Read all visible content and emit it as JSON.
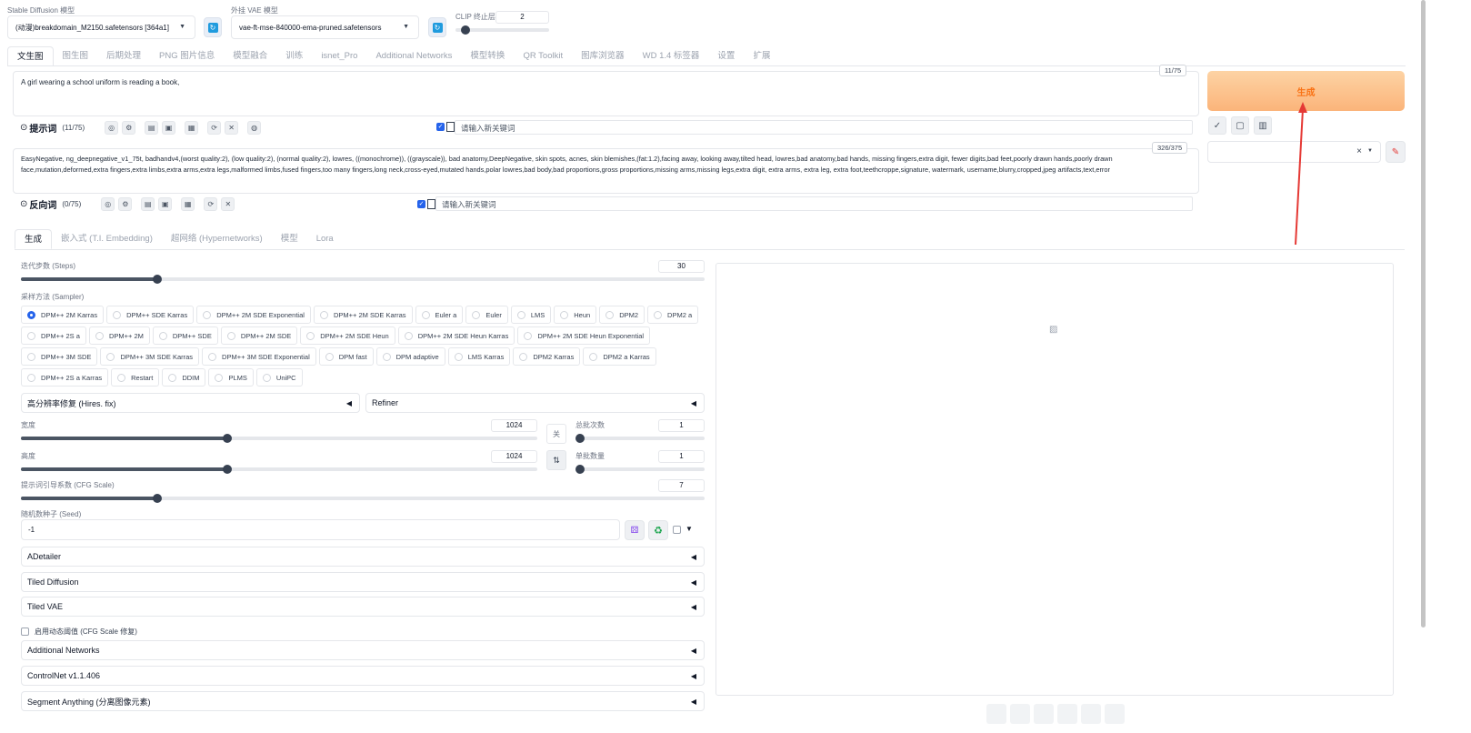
{
  "top": {
    "model_label": "Stable Diffusion 模型",
    "model_value": "(动漫)breakdomain_M2150.safetensors [364a1]",
    "vae_label": "外挂 VAE 模型",
    "vae_value": "vae-ft-mse-840000-ema-pruned.safetensors",
    "clip_label": "CLIP 终止层数",
    "clip_value": "2"
  },
  "main_tabs": [
    "文生图",
    "图生图",
    "后期处理",
    "PNG 图片信息",
    "模型融合",
    "训练",
    "isnet_Pro",
    "Additional Networks",
    "模型转换",
    "QR Toolkit",
    "图库浏览器",
    "WD 1.4 标签器",
    "设置",
    "扩展"
  ],
  "prompt": {
    "text": "A girl wearing a school uniform is reading a book,",
    "counter": "11/75",
    "label": "提示词",
    "count": "(11/75)",
    "keyword_placeholder": "请输入新关键词"
  },
  "negative": {
    "text": "EasyNegative, ng_deepnegative_v1_75t, badhandv4,(worst quality:2), (low quality:2), (normal quality:2), lowres, ((monochrome)), ((grayscale)), bad anatomy,DeepNegative, skin spots, acnes, skin blemishes,(fat:1.2),facing away, looking away,tilted head, lowres,bad anatomy,bad hands, missing fingers,extra digit, fewer digits,bad feet,poorly drawn hands,poorly drawn face,mutation,deformed,extra fingers,extra limbs,extra arms,extra legs,malformed limbs,fused fingers,too many fingers,long neck,cross-eyed,mutated hands,polar lowres,bad body,bad proportions,gross proportions,missing arms,missing legs,extra digit, extra arms, extra leg, extra foot,teethcroppe,signature, watermark, username,blurry,cropped,jpeg artifacts,text,error",
    "counter": "326/375",
    "label": "反向词",
    "count": "(0/75)",
    "keyword_placeholder": "请输入新关键词"
  },
  "generate_label": "生成",
  "sub_tabs": [
    "生成",
    "嵌入式 (T.I. Embedding)",
    "超网络 (Hypernetworks)",
    "模型",
    "Lora"
  ],
  "steps": {
    "label": "迭代步数 (Steps)",
    "value": "30",
    "fraction": 0.2
  },
  "sampler": {
    "label": "采样方法 (Sampler)",
    "selected": "DPM++ 2M Karras",
    "rows": [
      [
        "DPM++ 2M Karras",
        "DPM++ SDE Karras",
        "DPM++ 2M SDE Exponential",
        "DPM++ 2M SDE Karras",
        "Euler a",
        "Euler",
        "LMS",
        "Heun",
        "DPM2",
        "DPM2 a"
      ],
      [
        "DPM++ 2S a",
        "DPM++ 2M",
        "DPM++ SDE",
        "DPM++ 2M SDE",
        "DPM++ 2M SDE Heun",
        "DPM++ 2M SDE Heun Karras",
        "DPM++ 2M SDE Heun Exponential"
      ],
      [
        "DPM++ 3M SDE",
        "DPM++ 3M SDE Karras",
        "DPM++ 3M SDE Exponential",
        "DPM fast",
        "DPM adaptive",
        "LMS Karras",
        "DPM2 Karras",
        "DPM2 a Karras"
      ],
      [
        "DPM++ 2S a Karras",
        "Restart",
        "DDIM",
        "PLMS",
        "UniPC"
      ]
    ]
  },
  "hires_label": "高分辨率修复 (Hires. fix)",
  "refiner_label": "Refiner",
  "width": {
    "label": "宽度",
    "value": "1024",
    "fraction": 0.4
  },
  "height": {
    "label": "高度",
    "value": "1024",
    "fraction": 0.4
  },
  "swap_label": "关",
  "batch_count": {
    "label": "总批次数",
    "value": "1",
    "fraction": 0.0
  },
  "batch_size": {
    "label": "单批数量",
    "value": "1",
    "fraction": 0.0
  },
  "cfg": {
    "label": "提示词引导系数 (CFG Scale)",
    "value": "7",
    "fraction": 0.2
  },
  "seed": {
    "label": "随机数种子 (Seed)",
    "value": "-1"
  },
  "accordions_a": [
    "ADetailer",
    "Tiled Diffusion",
    "Tiled VAE"
  ],
  "dyn_label": "启用动态阈值 (CFG Scale 修复)",
  "accordions_b": [
    "Additional Networks",
    "ControlNet v1.1.406",
    "Segment Anything (分离图像元素)"
  ],
  "colors": {
    "generate_top": "#fdd3a4",
    "generate_bottom": "#fbb47a",
    "generate_text": "#f97316",
    "accent": "#2563eb",
    "arrow": "#e53935"
  }
}
